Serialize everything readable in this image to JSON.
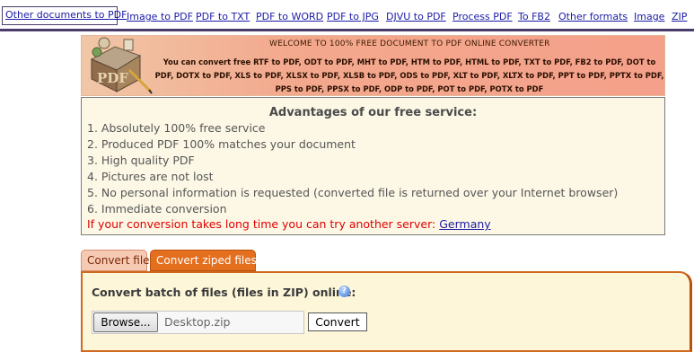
{
  "nav": {
    "active_label": "Other documents to PDF",
    "links": [
      "Image to PDF",
      "PDF to TXT",
      "PDF to WORD",
      "PDF to JPG",
      "DJVU to PDF",
      "Process PDF",
      "To FB2",
      "Other formats",
      "Image",
      "ZIP"
    ]
  },
  "banner": {
    "title": "WELCOME TO 100% FREE DOCUMENT TO PDF ONLINE CONVERTER",
    "text": "You can convert free RTF to PDF, ODT to PDF, MHT to PDF, HTM to PDF, HTML to PDF, TXT to PDF, FB2 to PDF, DOT to PDF, DOTX to PDF, XLS to PDF, XLSX to PDF, XLSB to PDF, ODS to PDF, XLT to PDF, XLTX to PDF, PPT to PDF, PPTX to PDF, PPS to PDF, PPSX to PDF, ODP to PDF, POT to PDF, POTX to PDF"
  },
  "advantages": {
    "title": "Advantages of our free service:",
    "items": [
      "1. Absolutely 100% free service",
      "2. Produced PDF 100% matches your document",
      "3. High quality PDF",
      "4. Pictures are not lost",
      "5. No personal information is requested (converted file is returned over your Internet browser)",
      "6. Immediate conversion"
    ],
    "warning": "If your conversion takes long time you can try another server:",
    "server_link": "Germany"
  },
  "tabs": {
    "file": "Convert file",
    "zip": "Convert ziped files"
  },
  "panel": {
    "heading": "Convert batch of files (files in ZIP) online:",
    "help_glyph": "?",
    "browse_label": "Browse...",
    "file_name": "Desktop.zip",
    "convert_label": "Convert"
  },
  "colors": {
    "nav_link": "#1a1aa6",
    "nav_bar": "#4b3b6b",
    "warning": "#e00000",
    "tab_active": "#e46f1f",
    "panel_bg": "#fdf6d9"
  }
}
